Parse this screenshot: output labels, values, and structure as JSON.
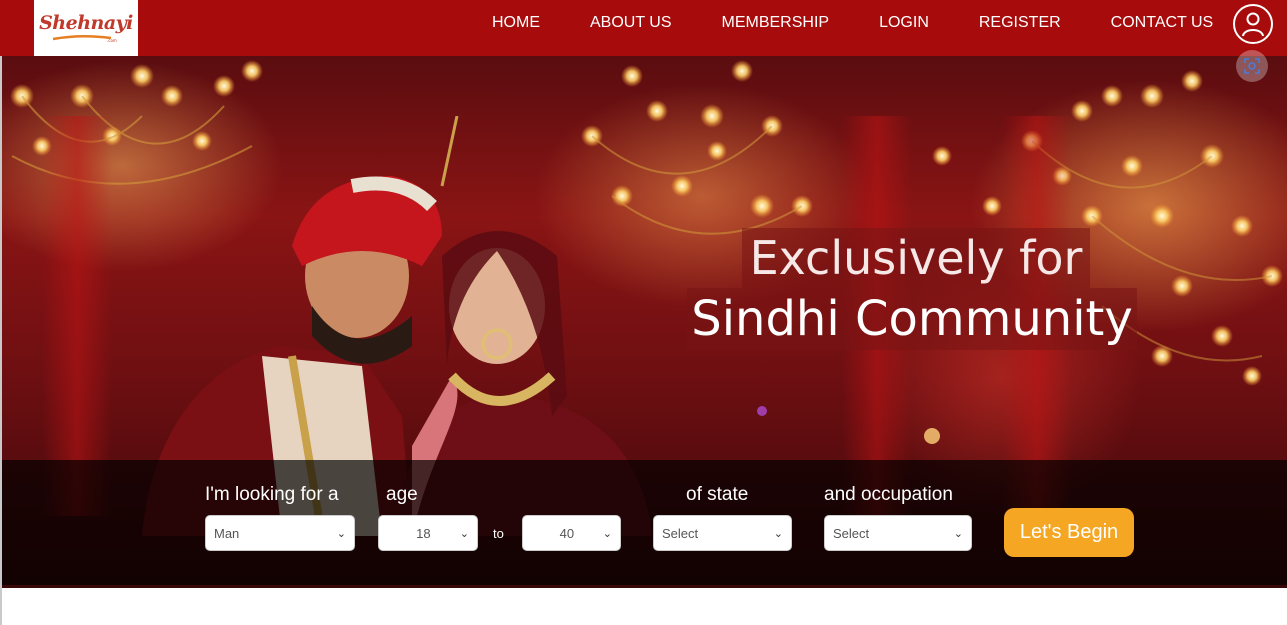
{
  "brand": {
    "logo_text": "Shehnayi",
    "logo_subtext": ".com"
  },
  "nav": {
    "items": [
      {
        "label": "HOME"
      },
      {
        "label": "ABOUT US"
      },
      {
        "label": "MEMBERSHIP"
      },
      {
        "label": "LOGIN"
      },
      {
        "label": "REGISTER"
      },
      {
        "label": "CONTACT US"
      }
    ],
    "user_icon": "user-circle-icon"
  },
  "hero": {
    "headline_line1": "Exclusively for",
    "headline_line2": "Sindhi Community",
    "image_icon": "lens-search-icon"
  },
  "search": {
    "looking_for_label": "I'm looking for a",
    "looking_for_value": "Man",
    "age_label": "age",
    "age_from": "18",
    "age_to_label": "to",
    "age_to": "40",
    "state_label": "of state",
    "state_value": "Select",
    "occupation_label": "and occupation",
    "occupation_value": "Select",
    "cta_label": "Let's Begin"
  },
  "colors": {
    "nav_bg": "#a70b0b",
    "cta_bg": "#f5a623",
    "strip_bg": "rgba(0,0,0,0.68)"
  }
}
